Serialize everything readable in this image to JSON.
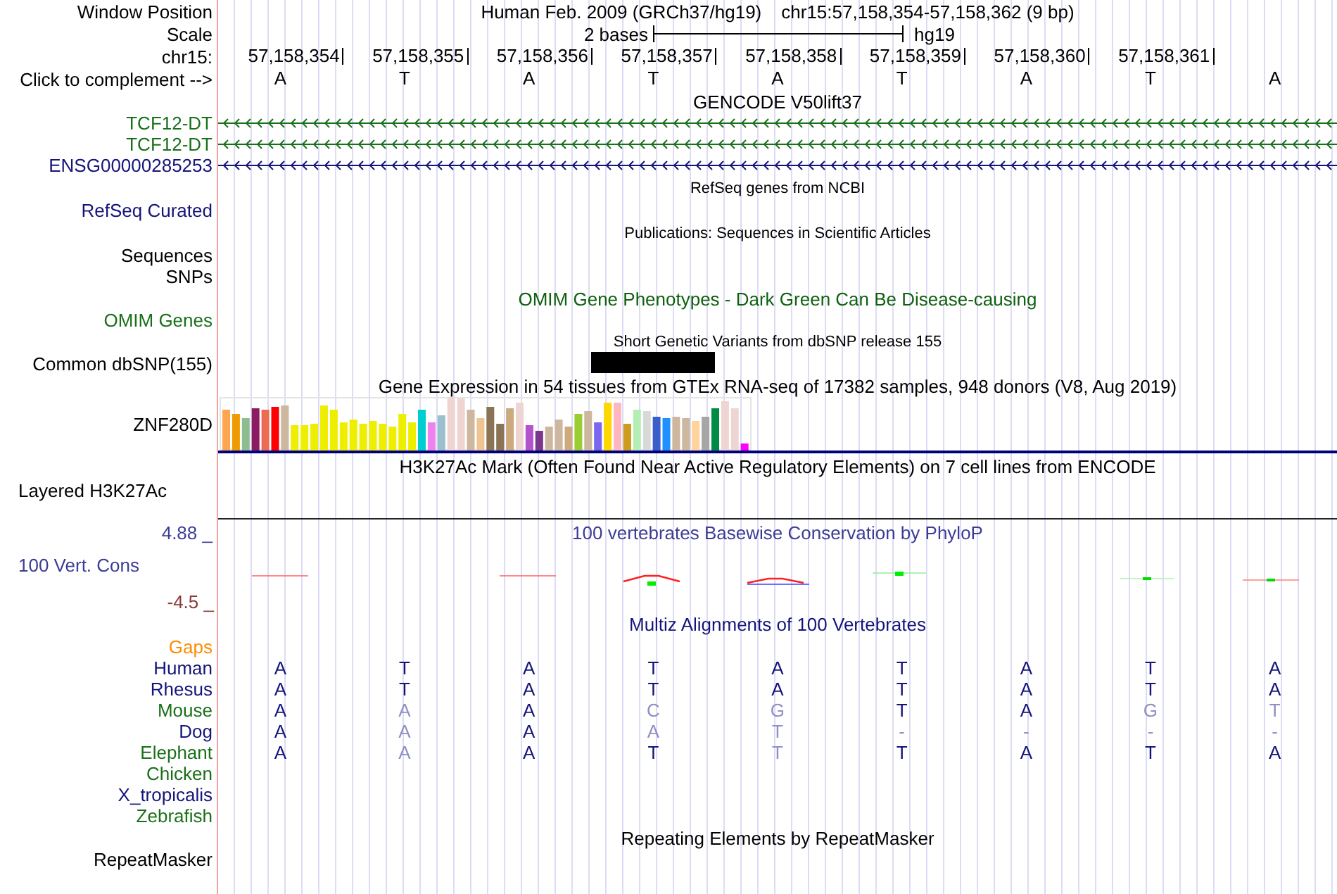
{
  "header": {
    "position_label": "Window Position",
    "title": "Human Feb. 2009 (GRCh37/hg19)",
    "location": "chr15:57,158,354-57,158,362 (9 bp)",
    "scale_label": "Scale",
    "scale_text": "2 bases",
    "assembly": "hg19",
    "chrom_label": "chr15:",
    "positions": [
      "57,158,354",
      "57,158,355",
      "57,158,356",
      "57,158,357",
      "57,158,358",
      "57,158,359",
      "57,158,360",
      "57,158,361"
    ],
    "complement_label": "Click to complement -->",
    "bases": [
      "A",
      "T",
      "A",
      "T",
      "A",
      "T",
      "A",
      "T",
      "A"
    ]
  },
  "tracks": [
    {
      "kind": "genes",
      "title": "GENCODE V50lift37",
      "items": [
        {
          "name": "TCF12-DT",
          "color": "#1a701a"
        },
        {
          "name": "TCF12-DT",
          "color": "#1a701a"
        },
        {
          "name": "ENSG00000285253",
          "color": "#14147a"
        }
      ]
    },
    {
      "kind": "blank",
      "title": "RefSeq genes from NCBI",
      "labels": [
        {
          "text": "RefSeq Curated",
          "color": "#14147a"
        }
      ]
    },
    {
      "kind": "blank",
      "title": "Publications: Sequences in Scientific Articles",
      "labels": [
        {
          "text": "Sequences"
        },
        {
          "text": "SNPs"
        }
      ]
    },
    {
      "kind": "plain",
      "title": "OMIM Gene Phenotypes - Dark Green Can Be Disease-causing",
      "color": "#0f5f0f",
      "labels": [
        {
          "text": "OMIM Genes",
          "color": "#1a701a"
        }
      ]
    },
    {
      "kind": "variants",
      "title": "Short Genetic Variants from dbSNP release 155",
      "labels": [
        {
          "text": "Common dbSNP(155)"
        }
      ]
    },
    {
      "kind": "expression",
      "title": "Gene Expression in 54 tissues from GTEx RNA-seq of 17382 samples, 948 donors (V8, Aug 2019)",
      "labels": [
        {
          "text": "ZNF280D"
        }
      ]
    },
    {
      "kind": "layered",
      "title": "H3K27Ac Mark (Often Found Near Active Regulatory Elements) on 7 cell lines from ENCODE",
      "labels": [
        {
          "text": "Layered H3K27Ac"
        }
      ]
    },
    {
      "kind": "conservation",
      "title": "100 vertebrates Basewise Conservation by PhyloP",
      "color": "#3c3c96",
      "labels": [
        {
          "text": "4.88 _",
          "color": "#3c3c96"
        },
        {
          "text": "100 Vert. Cons",
          "color": "#3c3c96"
        },
        {
          "text": "-4.5 _",
          "color": "#8b3a3a"
        }
      ]
    },
    {
      "kind": "alignment",
      "title": "Multiz Alignments of 100 Vertebrates",
      "color": "#14147a",
      "labels": [
        {
          "text": "Gaps",
          "color": "#ff8c00"
        }
      ],
      "species": [
        {
          "name": "Human",
          "color": "#14147a",
          "bases": [
            {
              "b": "A",
              "dim": false
            },
            {
              "b": "T",
              "dim": false
            },
            {
              "b": "A",
              "dim": false
            },
            {
              "b": "T",
              "dim": false
            },
            {
              "b": "A",
              "dim": false
            },
            {
              "b": "T",
              "dim": false
            },
            {
              "b": "A",
              "dim": false
            },
            {
              "b": "T",
              "dim": false
            },
            {
              "b": "A",
              "dim": false
            }
          ]
        },
        {
          "name": "Rhesus",
          "color": "#14147a",
          "bases": [
            {
              "b": "A",
              "dim": false
            },
            {
              "b": "T",
              "dim": false
            },
            {
              "b": "A",
              "dim": false
            },
            {
              "b": "T",
              "dim": false
            },
            {
              "b": "A",
              "dim": false
            },
            {
              "b": "T",
              "dim": false
            },
            {
              "b": "A",
              "dim": false
            },
            {
              "b": "T",
              "dim": false
            },
            {
              "b": "A",
              "dim": false
            }
          ]
        },
        {
          "name": "Mouse",
          "color": "#1a701a",
          "bases": [
            {
              "b": "A",
              "dim": false
            },
            {
              "b": "A",
              "dim": true
            },
            {
              "b": "A",
              "dim": false
            },
            {
              "b": "C",
              "dim": true
            },
            {
              "b": "G",
              "dim": true
            },
            {
              "b": "T",
              "dim": false
            },
            {
              "b": "A",
              "dim": false
            },
            {
              "b": "G",
              "dim": true
            },
            {
              "b": "T",
              "dim": true
            }
          ]
        },
        {
          "name": "Dog",
          "color": "#14147a",
          "bases": [
            {
              "b": "A",
              "dim": false
            },
            {
              "b": "A",
              "dim": true
            },
            {
              "b": "A",
              "dim": false
            },
            {
              "b": "A",
              "dim": true
            },
            {
              "b": "T",
              "dim": true
            },
            {
              "b": "-",
              "dim": true
            },
            {
              "b": "-",
              "dim": true
            },
            {
              "b": "-",
              "dim": true
            },
            {
              "b": "-",
              "dim": true
            }
          ]
        },
        {
          "name": "Elephant",
          "color": "#1a701a",
          "bases": [
            {
              "b": "A",
              "dim": false
            },
            {
              "b": "A",
              "dim": true
            },
            {
              "b": "A",
              "dim": false
            },
            {
              "b": "T",
              "dim": false
            },
            {
              "b": "T",
              "dim": true
            },
            {
              "b": "T",
              "dim": false
            },
            {
              "b": "A",
              "dim": false
            },
            {
              "b": "T",
              "dim": false
            },
            {
              "b": "A",
              "dim": false
            }
          ]
        },
        {
          "name": "Chicken",
          "color": "#1a701a"
        },
        {
          "name": "X_tropicalis",
          "color": "#14147a"
        },
        {
          "name": "Zebrafish",
          "color": "#1a701a"
        }
      ]
    },
    {
      "kind": "plain",
      "title": "Repeating Elements by RepeatMasker",
      "labels": [
        {
          "text": "RepeatMasker"
        }
      ]
    }
  ]
}
